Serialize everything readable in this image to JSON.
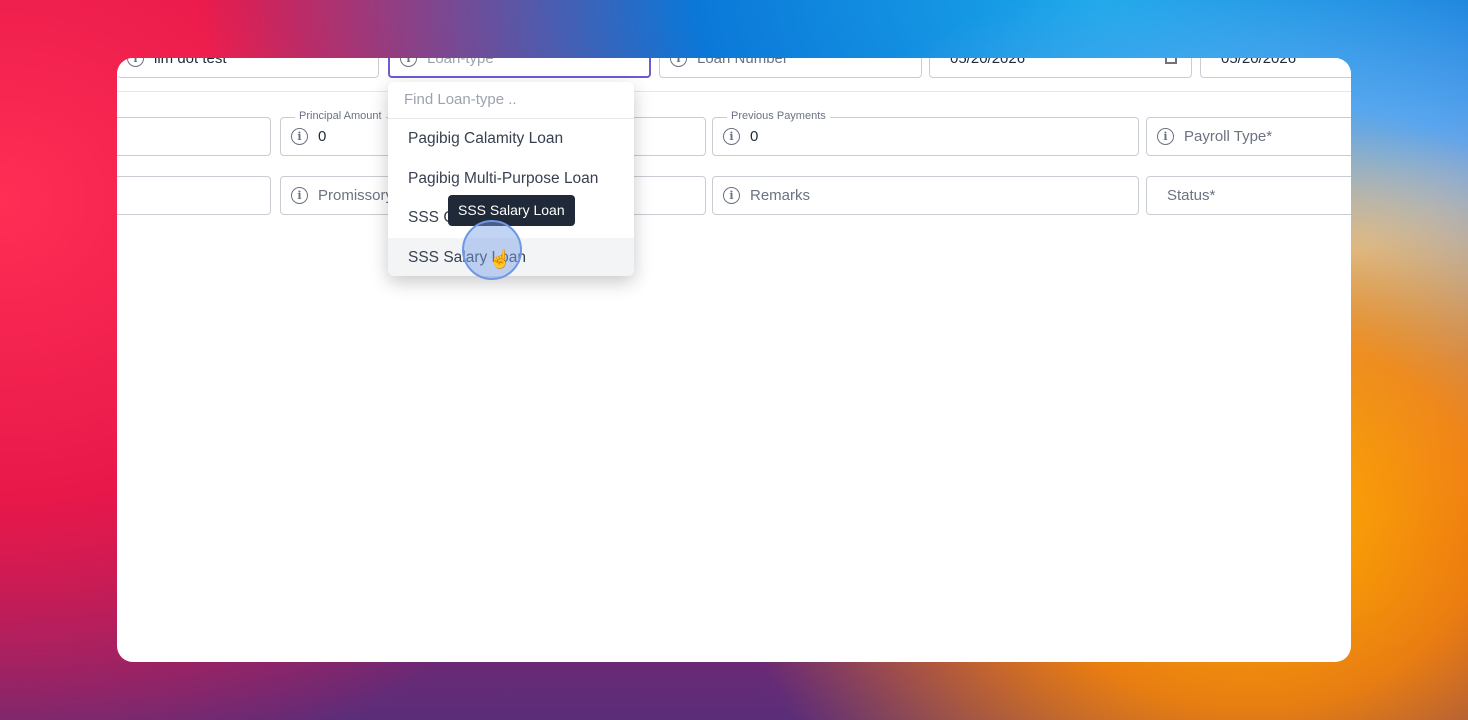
{
  "row1": {
    "employee_value": "lim dot test",
    "loan_type_placeholder": "Loan-type",
    "loan_number_placeholder": "Loan Number",
    "date_1": "05/20/2026",
    "date_2": "05/20/2026"
  },
  "row2": {
    "principal_label": "Principal Amount",
    "principal_value": "0",
    "previous_payments_label": "Previous Payments",
    "previous_payments_value": "0",
    "payroll_type_placeholder": "Payroll Type*"
  },
  "row3": {
    "promissory_placeholder": "Promissory",
    "remarks_placeholder": "Remarks",
    "status_placeholder": "Status*"
  },
  "dropdown": {
    "search_placeholder": "Find Loan-type ..",
    "options": [
      "Pagibig Calamity Loan",
      "Pagibig Multi-Purpose Loan",
      "SSS Calamity Loan",
      "SSS Salary Loan"
    ],
    "tooltip": "SSS Salary Loan"
  },
  "colors": {
    "focus_border": "#6d5bd0",
    "tooltip_bg": "#1f2937"
  }
}
